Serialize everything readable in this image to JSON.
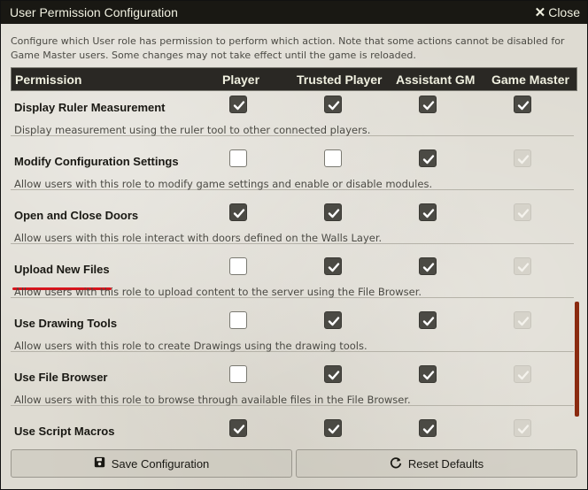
{
  "window": {
    "title": "User Permission Configuration",
    "close_label": "Close"
  },
  "notes": "Configure which User role has permission to perform which action. Note that some actions cannot be disabled for Game Master users. Some changes may not take effect until the game is reloaded.",
  "columns": [
    "Permission",
    "Player",
    "Trusted Player",
    "Assistant GM",
    "Game Master"
  ],
  "permissions": [
    {
      "label": "Display Ruler Measurement",
      "hint": "Display measurement using the ruler tool to other connected players.",
      "player": "checked",
      "trusted": "checked",
      "assistant": "checked",
      "gm": "checked"
    },
    {
      "label": "Modify Configuration Settings",
      "hint": "Allow users with this role to modify game settings and enable or disable modules.",
      "player": "unchecked",
      "trusted": "unchecked",
      "assistant": "checked",
      "gm": "disabled"
    },
    {
      "label": "Open and Close Doors",
      "hint": "Allow users with this role interact with doors defined on the Walls Layer.",
      "player": "checked",
      "trusted": "checked",
      "assistant": "checked",
      "gm": "disabled"
    },
    {
      "label": "Upload New Files",
      "hint": "Allow users with this role to upload content to the server using the File Browser.",
      "player": "unchecked",
      "trusted": "checked",
      "assistant": "checked",
      "gm": "disabled"
    },
    {
      "label": "Use Drawing Tools",
      "hint": "Allow users with this role to create Drawings using the drawing tools.",
      "player": "unchecked",
      "trusted": "checked",
      "assistant": "checked",
      "gm": "disabled"
    },
    {
      "label": "Use File Browser",
      "hint": "Allow users with this role to browse through available files in the File Browser.",
      "player": "unchecked",
      "trusted": "checked",
      "assistant": "checked",
      "gm": "disabled"
    },
    {
      "label": "Use Script Macros",
      "hint": "",
      "player": "checked",
      "trusted": "checked",
      "assistant": "checked",
      "gm": "disabled"
    }
  ],
  "footer": {
    "save_label": "Save Configuration",
    "reset_label": "Reset Defaults",
    "save_icon": "floppy-disk-icon",
    "reset_icon": "refresh-icon"
  },
  "colors": {
    "titlebar": "#191813",
    "header": "#2a2824",
    "checked_box": "#4b4a44",
    "highlight_underline": "#d8141c",
    "scrollbar": "#8a2a10"
  }
}
